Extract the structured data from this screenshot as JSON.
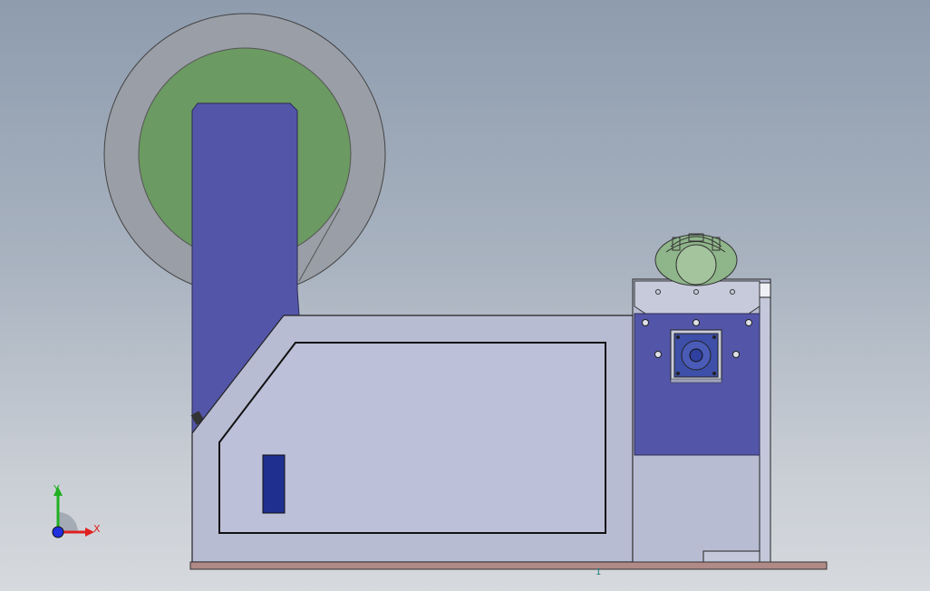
{
  "colors": {
    "background_top": "#8e9cae",
    "background_bottom": "#d6d9dd",
    "reel_outer": "#9a9ea6",
    "reel_inner": "#6b9a62",
    "arm": "#5356a8",
    "housing": "#b5bad2",
    "housing_panel": "#bcc0d8",
    "motor_plate": "#5356a8",
    "motor_top": "#c7cadb",
    "gear_motor": "#8fb58a",
    "base_plate": "#b08a86",
    "window": "#1f2f8f",
    "axis_x": "#e02020",
    "axis_y": "#20b020",
    "axis_z": "#2030e0"
  },
  "triad": {
    "x_label": "X",
    "y_label": "Y"
  },
  "origin_marker": "1",
  "icons": {
    "reel": "reel-icon",
    "gear_motor": "gear-motor-icon",
    "servo_motor": "servo-motor-icon",
    "triad": "axis-triad-icon"
  }
}
